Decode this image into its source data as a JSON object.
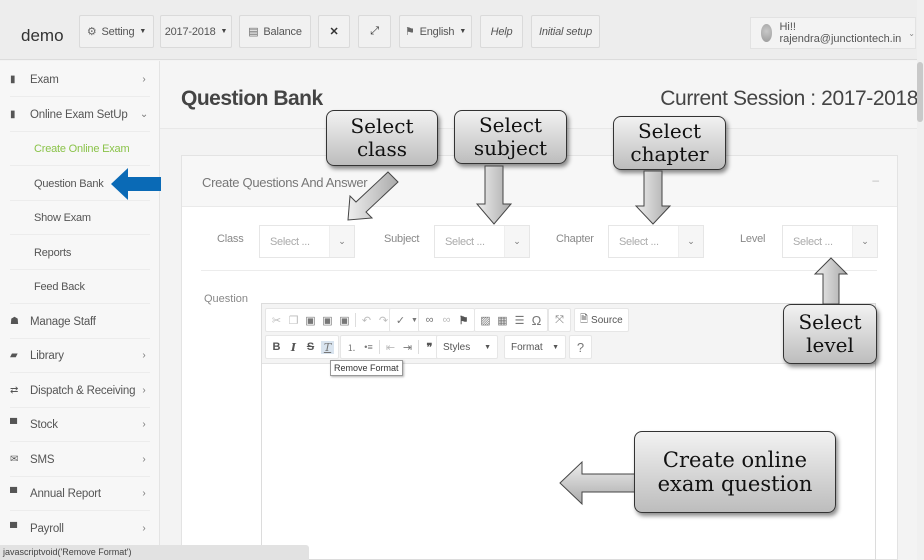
{
  "topbar": {
    "brand": "demo",
    "buttons": [
      {
        "label": "Setting",
        "icon": "gear-icon",
        "has_caret": true
      },
      {
        "label": "2017-2018",
        "has_caret": true
      },
      {
        "label": "Balance",
        "icon": "database-icon"
      },
      {
        "label": "",
        "icon": "compress-icon"
      },
      {
        "label": "",
        "icon": "expand-icon"
      },
      {
        "label": "English",
        "icon": "language-icon",
        "has_caret": true
      },
      {
        "label": "Help"
      },
      {
        "label": "Initial setup"
      }
    ],
    "user_greeting": "Hi!! rajendra@junctiontech.in"
  },
  "sidebar": {
    "items": [
      {
        "label": "Exam",
        "icon": "file-icon",
        "arrow": "›"
      },
      {
        "label": "Online Exam SetUp",
        "icon": "file-icon",
        "arrow": "⌄"
      },
      {
        "label": "Manage Staff",
        "icon": "users-icon"
      },
      {
        "label": "Library",
        "icon": "book-icon",
        "arrow": "›"
      },
      {
        "label": "Dispatch & Receiving",
        "icon": "exchange-icon",
        "arrow": "›"
      },
      {
        "label": "Stock",
        "icon": "cart-icon",
        "arrow": "›"
      },
      {
        "label": "SMS",
        "icon": "envelope-icon",
        "arrow": "›"
      },
      {
        "label": "Annual Report",
        "icon": "cart-icon",
        "arrow": "›"
      },
      {
        "label": "Payroll",
        "icon": "cart-icon",
        "arrow": "›"
      }
    ],
    "subitems": [
      {
        "label": "Create Online Exam",
        "active": true
      },
      {
        "label": "Question Bank"
      },
      {
        "label": "Show Exam"
      },
      {
        "label": "Reports"
      },
      {
        "label": "Feed Back"
      }
    ]
  },
  "header": {
    "title": "Question Bank",
    "session": "Current Session : 2017-2018"
  },
  "panel": {
    "title": "Create Questions And Answer",
    "collapse_symbol": "–",
    "fields": [
      {
        "label": "Class",
        "value": "Select ..."
      },
      {
        "label": "Subject",
        "value": "Select ..."
      },
      {
        "label": "Chapter",
        "value": "Select ..."
      },
      {
        "label": "Level",
        "value": "Select ..."
      }
    ],
    "question_label": "Question"
  },
  "editor": {
    "source_label": "Source",
    "styles_label": "Styles",
    "format_label": "Format",
    "help_symbol": "?",
    "tooltip": "Remove Format"
  },
  "statusbar": "javascriptvoid('Remove Format')",
  "callouts": {
    "class": "Select\nclass",
    "subject": "Select\nsubject",
    "chapter": "Select\nchapter",
    "level": "Select\nlevel",
    "question": "Create online\nexam question"
  },
  "colors": {
    "active_menu": "#8bc34a",
    "blue_arrow": "#0a6ab6"
  }
}
